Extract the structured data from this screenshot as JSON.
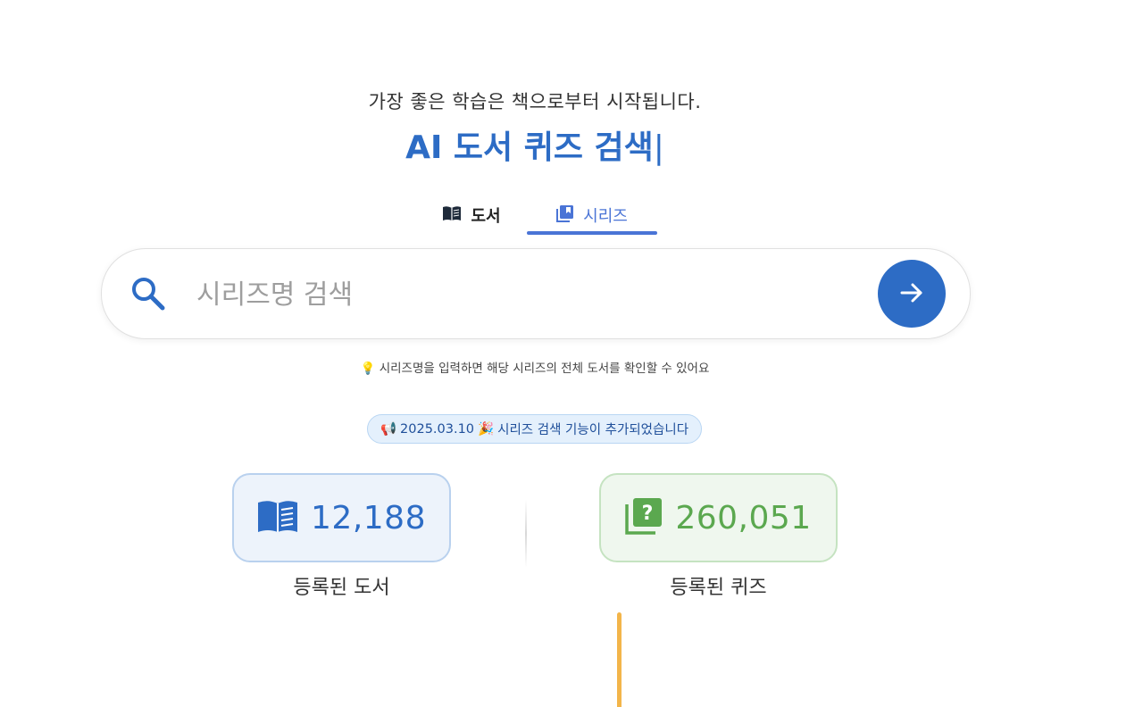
{
  "header": {
    "subtitle": "가장 좋은 학습은 책으로부터 시작됩니다.",
    "title": "AI 도서 퀴즈 검색",
    "cursor": "|"
  },
  "tabs": [
    {
      "label": "도서",
      "icon": "book-open-icon",
      "active": false
    },
    {
      "label": "시리즈",
      "icon": "library-books-icon",
      "active": true
    }
  ],
  "search": {
    "placeholder": "시리즈명 검색",
    "value": "",
    "submit_icon": "arrow-right-icon"
  },
  "hint": {
    "icon": "💡",
    "text": "시리즈명을 입력하면 해당 시리즈의 전체 도서를 확인할 수 있어요"
  },
  "notice": {
    "icon": "📢",
    "date": "2025.03.10",
    "emoji": "🎉",
    "text": "시리즈 검색 기능이 추가되었습니다"
  },
  "stats": {
    "books": {
      "value": "12,188",
      "label": "등록된 도서",
      "icon": "book-icon"
    },
    "quizzes": {
      "value": "260,051",
      "label": "등록된 퀴즈",
      "icon": "quiz-icon"
    }
  },
  "colors": {
    "primary": "#2d6cc5",
    "tab_active": "#4a74d6",
    "quiz_green": "#5ba84f",
    "accent_orange": "#f3b54a"
  }
}
